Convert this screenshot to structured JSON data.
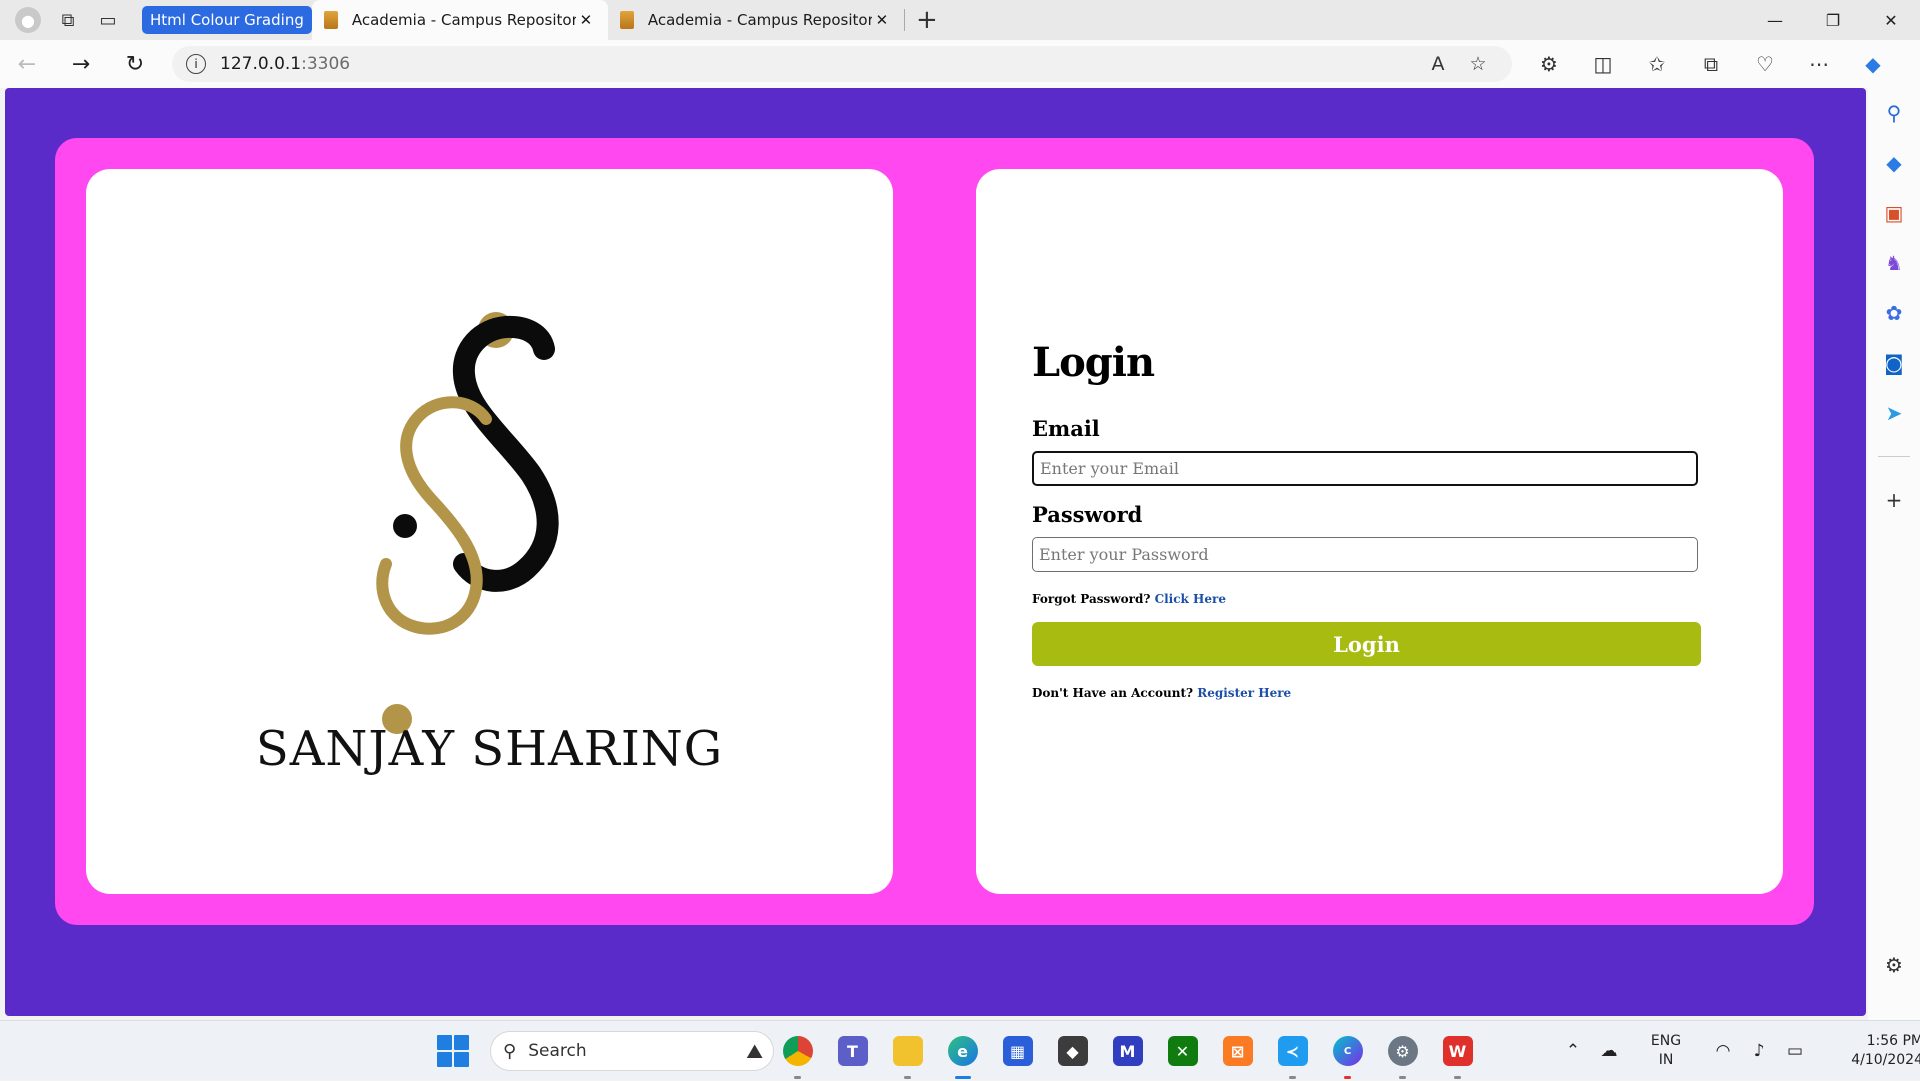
{
  "browser": {
    "tab_group_label": "Html Colour Grading",
    "tabs": [
      {
        "title": "Academia - Campus Repository",
        "close": "✕"
      },
      {
        "title": "Academia - Campus Repository",
        "close": "✕"
      }
    ],
    "new_tab": "+",
    "window_controls": {
      "minimize": "—",
      "restore": "❐",
      "close": "✕"
    },
    "url_host": "127.0.0.1",
    "url_port": ":3306",
    "icons": {
      "back": "back-arrow-icon",
      "forward": "forward-arrow-icon",
      "reload": "reload-icon",
      "info": "info-icon",
      "read_aloud": "read-aloud-icon",
      "favorite": "star-icon"
    }
  },
  "logo": {
    "brand_text": "SANJAY SHARING",
    "colors": {
      "gold": "#b3954a",
      "black": "#0b0b0b"
    }
  },
  "login": {
    "title": "Login",
    "email_label": "Email",
    "email_placeholder": "Enter your Email",
    "password_label": "Password",
    "password_placeholder": "Enter your Password",
    "forgot_text": "Forgot Password?",
    "forgot_link": "Click Here",
    "button_label": "Login",
    "register_text": "Don't Have an Account?",
    "register_link": "Register Here"
  },
  "colors": {
    "page_bg": "#5b2bca",
    "frame": "#ff48f0",
    "card": "#ffffff",
    "button": "#a8bb10",
    "link": "#1b4fa8"
  },
  "taskbar": {
    "search_label": "Search",
    "lang_line1": "ENG",
    "lang_line2": "IN",
    "time": "1:56 PM",
    "date": "4/10/2024"
  }
}
